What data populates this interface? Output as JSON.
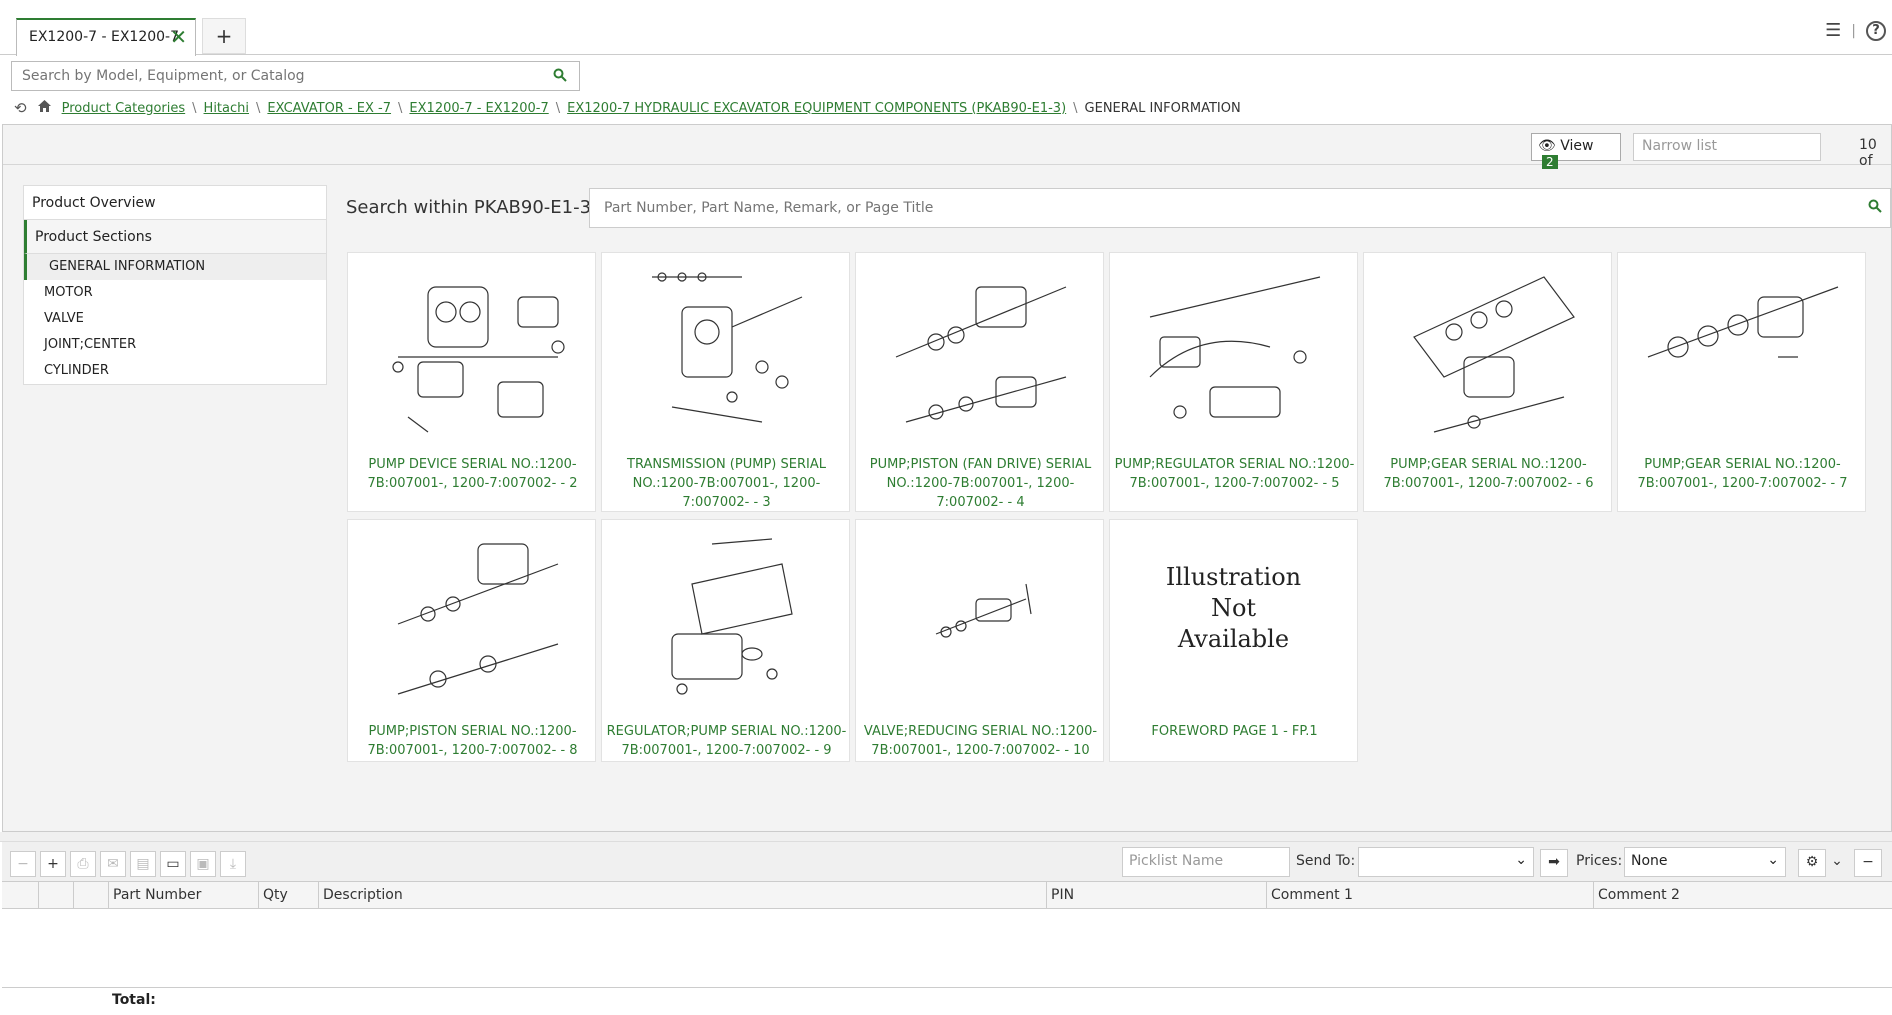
{
  "tabs": [
    {
      "label": "EX1200-7 - EX1200-7"
    }
  ],
  "new_tab_label": "+",
  "search": {
    "placeholder": "Search by Model, Equipment, or Catalog"
  },
  "breadcrumb": {
    "items": [
      "Product Categories",
      "Hitachi",
      "EXCAVATOR - EX -7",
      "EX1200-7 - EX1200-7",
      "EX1200-7 HYDRAULIC EXCAVATOR EQUIPMENT COMPONENTS (PKAB90-E1-3)"
    ],
    "current": "GENERAL INFORMATION",
    "separator": "\\"
  },
  "toolbar": {
    "view_label": "View",
    "view_badge": "2",
    "narrow_placeholder": "Narrow list",
    "count": "10 of"
  },
  "nav": {
    "overview": "Product Overview",
    "sections": "Product Sections",
    "items": [
      "GENERAL INFORMATION",
      "MOTOR",
      "VALVE",
      "JOINT;CENTER",
      "CYLINDER"
    ]
  },
  "within": {
    "label": "Search within PKAB90-E1-3",
    "placeholder": "Part Number, Part Name, Remark, or Page Title"
  },
  "cards": [
    {
      "title": "PUMP DEVICE SERIAL NO.:1200-7B:007001-, 1200-7:007002- - 2"
    },
    {
      "title": "TRANSMISSION (PUMP) SERIAL NO.:1200-7B:007001-, 1200-7:007002- - 3"
    },
    {
      "title": "PUMP;PISTON (FAN DRIVE) SERIAL NO.:1200-7B:007001-, 1200-7:007002- - 4"
    },
    {
      "title": "PUMP;REGULATOR SERIAL NO.:1200-7B:007001-, 1200-7:007002- - 5"
    },
    {
      "title": "PUMP;GEAR SERIAL NO.:1200-7B:007001-, 1200-7:007002- - 6"
    },
    {
      "title": "PUMP;GEAR SERIAL NO.:1200-7B:007001-, 1200-7:007002- - 7"
    },
    {
      "title": "PUMP;PISTON SERIAL NO.:1200-7B:007001-, 1200-7:007002- - 8"
    },
    {
      "title": "REGULATOR;PUMP SERIAL NO.:1200-7B:007001-, 1200-7:007002- - 9"
    },
    {
      "title": "VALVE;REDUCING SERIAL NO.:1200-7B:007001-, 1200-7:007002- - 10"
    },
    {
      "title": "FOREWORD PAGE 1 - FP.1",
      "na_lines": [
        "Illustration",
        "Not",
        "Available"
      ]
    }
  ],
  "picklist": {
    "name_placeholder": "Picklist Name",
    "send_to_label": "Send To:",
    "send_to_value": "",
    "prices_label": "Prices:",
    "prices_value": "None"
  },
  "table": {
    "columns": [
      "Part Number",
      "Qty",
      "Description",
      "PIN",
      "Comment 1",
      "Comment 2"
    ],
    "total_label": "Total:"
  },
  "colors": {
    "accent": "#2e7d32"
  }
}
